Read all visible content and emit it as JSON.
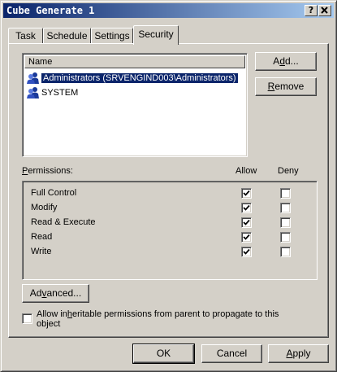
{
  "window": {
    "title": "Cube Generate 1",
    "help_button": "?",
    "close_button": "x"
  },
  "tabs": [
    {
      "label": "Task",
      "active": false
    },
    {
      "label": "Schedule",
      "active": false
    },
    {
      "label": "Settings",
      "active": false
    },
    {
      "label": "Security",
      "active": true
    }
  ],
  "names_list": {
    "column_header": "Name",
    "items": [
      {
        "label": "Administrators (SRVENGIND003\\Administrators)",
        "selected": true,
        "icon": "group-icon"
      },
      {
        "label": "SYSTEM",
        "selected": false,
        "icon": "group-icon"
      }
    ]
  },
  "buttons": {
    "add": {
      "pre": "A",
      "ul": "d",
      "post": "d..."
    },
    "remove": {
      "pre": "",
      "ul": "R",
      "post": "emove"
    },
    "advanced": {
      "pre": "Ad",
      "ul": "v",
      "post": "anced..."
    },
    "ok": "OK",
    "cancel": "Cancel",
    "apply": {
      "pre": "",
      "ul": "A",
      "post": "pply"
    }
  },
  "permissions": {
    "label": {
      "pre": "",
      "ul": "P",
      "post": "ermissions:"
    },
    "allow_header": "Allow",
    "deny_header": "Deny",
    "rows": [
      {
        "name": "Full Control",
        "allow": true,
        "deny": false
      },
      {
        "name": "Modify",
        "allow": true,
        "deny": false
      },
      {
        "name": "Read & Execute",
        "allow": true,
        "deny": false
      },
      {
        "name": "Read",
        "allow": true,
        "deny": false
      },
      {
        "name": "Write",
        "allow": true,
        "deny": false
      }
    ]
  },
  "inherit": {
    "line1_pre": "Allow in",
    "line1_ul": "h",
    "line1_post": "eritable permissions from parent to propagate to this",
    "line2": "object",
    "checked": false
  },
  "colors": {
    "title_gradient_start": "#0a246a",
    "title_gradient_end": "#a6caf0",
    "face": "#d4d0c8",
    "selection": "#0a246a"
  }
}
